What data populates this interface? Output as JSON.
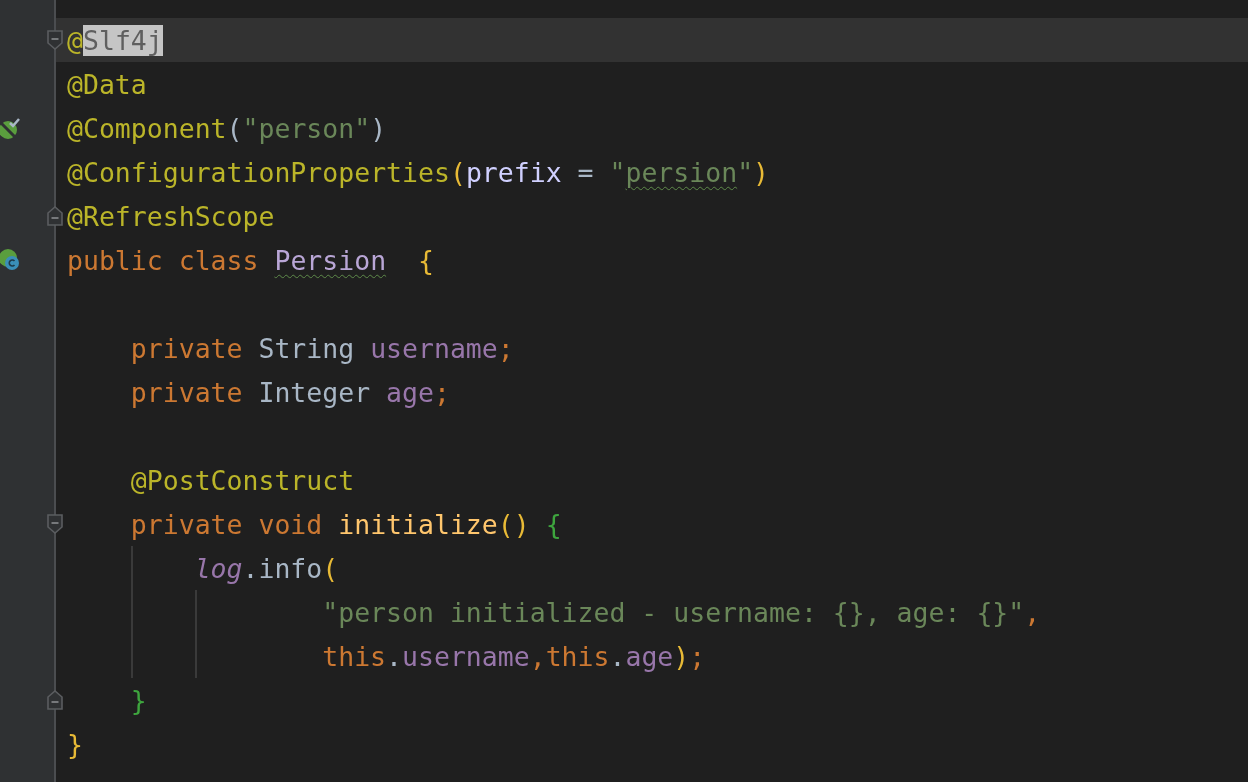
{
  "editor": {
    "lines": [
      {
        "current": true,
        "fold": {
          "kind": "start"
        },
        "tokens": [
          {
            "text": "@",
            "kind": "annotation"
          },
          {
            "text": "Slf4j",
            "kind": "unused",
            "highlighted": true
          }
        ]
      },
      {
        "tokens": [
          {
            "text": "@Data",
            "kind": "annotation"
          }
        ]
      },
      {
        "gutter_icon": {
          "kind": "bean"
        },
        "tokens": [
          {
            "text": "@Component",
            "kind": "annotation"
          },
          {
            "text": "(",
            "kind": "plain"
          },
          {
            "text": "\"person\"",
            "kind": "string"
          },
          {
            "text": ")",
            "kind": "plain"
          }
        ]
      },
      {
        "tokens": [
          {
            "text": "@ConfigurationProperties",
            "kind": "annotation"
          },
          {
            "text": "(",
            "kind": "bracket",
            "color": "#e8ba36"
          },
          {
            "text": "prefix",
            "kind": "param"
          },
          {
            "text": " = ",
            "kind": "plain"
          },
          {
            "text": "\"",
            "kind": "string"
          },
          {
            "text": "persion",
            "kind": "string",
            "squiggle": true
          },
          {
            "text": "\"",
            "kind": "string"
          },
          {
            "text": ")",
            "kind": "bracket",
            "color": "#e8ba36"
          }
        ]
      },
      {
        "fold": {
          "kind": "end"
        },
        "tokens": [
          {
            "text": "@RefreshScope",
            "kind": "annotation"
          }
        ]
      },
      {
        "gutter_icon": {
          "kind": "bean-class"
        },
        "tokens": [
          {
            "text": "public class ",
            "kind": "keyword"
          },
          {
            "text": "Persion",
            "kind": "class",
            "squiggle": true
          },
          {
            "text": "  {",
            "kind": "bracket",
            "color": "#e8ba36"
          }
        ]
      },
      {
        "blank_line_before": true,
        "indent": [
          {
            "guide": false
          }
        ],
        "tokens": [
          {
            "text": "private ",
            "kind": "keyword"
          },
          {
            "text": "String ",
            "kind": "plain"
          },
          {
            "text": "username",
            "kind": "field"
          },
          {
            "text": ";",
            "kind": "keyword"
          }
        ]
      },
      {
        "indent": [
          {
            "guide": false
          }
        ],
        "tokens": [
          {
            "text": "private ",
            "kind": "keyword"
          },
          {
            "text": "Integer ",
            "kind": "plain"
          },
          {
            "text": "age",
            "kind": "field"
          },
          {
            "text": ";",
            "kind": "keyword"
          }
        ]
      },
      {
        "blank_line_before": true,
        "indent": [
          {
            "guide": false
          }
        ],
        "tokens": [
          {
            "text": "@PostConstruct",
            "kind": "annotation"
          }
        ]
      },
      {
        "fold": {
          "kind": "start"
        },
        "indent": [
          {
            "guide": false
          }
        ],
        "tokens": [
          {
            "text": "private void ",
            "kind": "keyword"
          },
          {
            "text": "initialize",
            "kind": "method"
          },
          {
            "text": "() ",
            "kind": "bracket",
            "color": "#e8ba36"
          },
          {
            "text": "{",
            "kind": "bracket",
            "color": "#3ea53e"
          }
        ]
      },
      {
        "indent": [
          {
            "guide": false
          },
          {
            "guide": true
          }
        ],
        "tokens": [
          {
            "text": "log",
            "kind": "static-field"
          },
          {
            "text": ".info",
            "kind": "plain"
          },
          {
            "text": "(",
            "kind": "bracket",
            "color": "#e8ba36"
          }
        ]
      },
      {
        "indent": [
          {
            "guide": false
          },
          {
            "guide": true
          },
          {
            "guide": true
          },
          {
            "guide": false
          }
        ],
        "tokens": [
          {
            "text": "\"person initialized - username: {}, age: {}\"",
            "kind": "string"
          },
          {
            "text": ",",
            "kind": "keyword"
          }
        ]
      },
      {
        "indent": [
          {
            "guide": false
          },
          {
            "guide": true
          },
          {
            "guide": true
          },
          {
            "guide": false
          }
        ],
        "tokens": [
          {
            "text": "this",
            "kind": "keyword"
          },
          {
            "text": ".",
            "kind": "plain"
          },
          {
            "text": "username",
            "kind": "field"
          },
          {
            "text": ",",
            "kind": "keyword"
          },
          {
            "text": "this",
            "kind": "keyword"
          },
          {
            "text": ".",
            "kind": "plain"
          },
          {
            "text": "age",
            "kind": "field"
          },
          {
            "text": ")",
            "kind": "bracket",
            "color": "#e8ba36"
          },
          {
            "text": ";",
            "kind": "keyword"
          }
        ]
      },
      {
        "fold": {
          "kind": "end"
        },
        "indent": [
          {
            "guide": false
          }
        ],
        "tokens": [
          {
            "text": "}",
            "kind": "bracket",
            "color": "#3ea53e"
          }
        ]
      },
      {
        "tokens": [
          {
            "text": "}",
            "kind": "bracket",
            "color": "#e8ba36"
          }
        ]
      }
    ]
  }
}
